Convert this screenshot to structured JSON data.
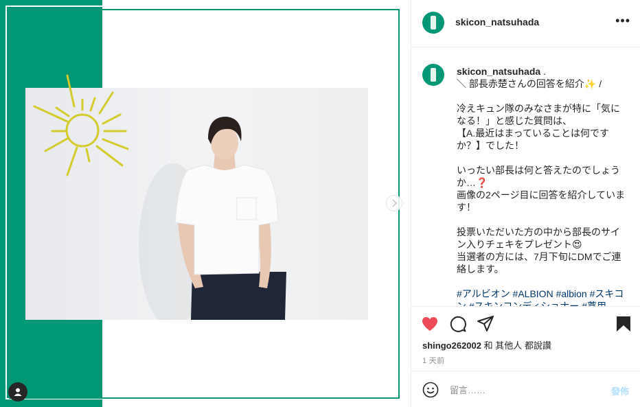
{
  "post": {
    "username": "skicon_natsuhada",
    "more_label": "•••"
  },
  "caption": {
    "username": "skicon_natsuhada",
    "text": " .\n＼ 部長赤楚さんの回答を紹介✨ /\n\n冷えキュン隊のみなさまが特に「気になる！」と感じた質問は、\n【A.最近はまっていることは何ですか？】でした！\n\nいったい部長は何と答えたのでしょうか…❓\n画像の2ページ目に回答を紹介しています！\n\n投票いただいた方の中から部長のサイン入りチェキをプレゼント😍\n当選者の方には、7月下旬にDMでご連絡します。\n\n",
    "hashtags": "#アルビオン #ALBION #albion #スキコン #スキンコンディショナー #薬用"
  },
  "likes": {
    "user": "shingo262002",
    "rest": " 和 其他人 都說讚"
  },
  "date": "1 天前",
  "comment": {
    "placeholder": "留言……",
    "post_label": "發佈"
  },
  "colors": {
    "brand_green": "#009774",
    "like_red": "#ed4956",
    "link_blue": "#00376b",
    "post_disabled": "#b2dffc"
  },
  "icons": [
    "heart-icon",
    "comment-icon",
    "share-icon",
    "bookmark-icon",
    "emoji-icon",
    "chevron-right-icon",
    "user-tag-icon",
    "more-icon"
  ]
}
